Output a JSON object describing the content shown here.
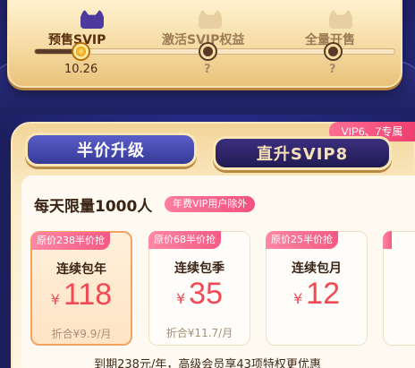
{
  "progress": {
    "steps": [
      {
        "label": "预售SVIP",
        "sub": "10.26",
        "active": true
      },
      {
        "label": "激活SVIP权益",
        "sub": "?",
        "active": false
      },
      {
        "label": "全量开售",
        "sub": "?",
        "active": false
      }
    ],
    "fill_fraction": 0.15
  },
  "vip_tag": "VIP6、7专属",
  "tabs": {
    "half": "半价升级",
    "direct": "直升SVIP8"
  },
  "limit": {
    "title": "每天限量1000人",
    "badge": "年费VIP用户除外"
  },
  "plans": [
    {
      "orig": "原价238半价抢",
      "name": "连续包年",
      "currency": "¥",
      "price": "118",
      "monthly": "折合¥9.9/月"
    },
    {
      "orig": "原价68半价抢",
      "name": "连续包季",
      "currency": "¥",
      "price": "35",
      "monthly": "折合¥11.7/月"
    },
    {
      "orig": "原价25半价抢",
      "name": "连续包月",
      "currency": "¥",
      "price": "12",
      "monthly": ""
    }
  ],
  "footer": "到期238元/年，高级会员享43项特权更优惠",
  "colors": {
    "accent_pink": "#f3517e",
    "price_red": "#f24a55",
    "brand_purple": "#363a98",
    "gold": "#f5d9a0"
  }
}
